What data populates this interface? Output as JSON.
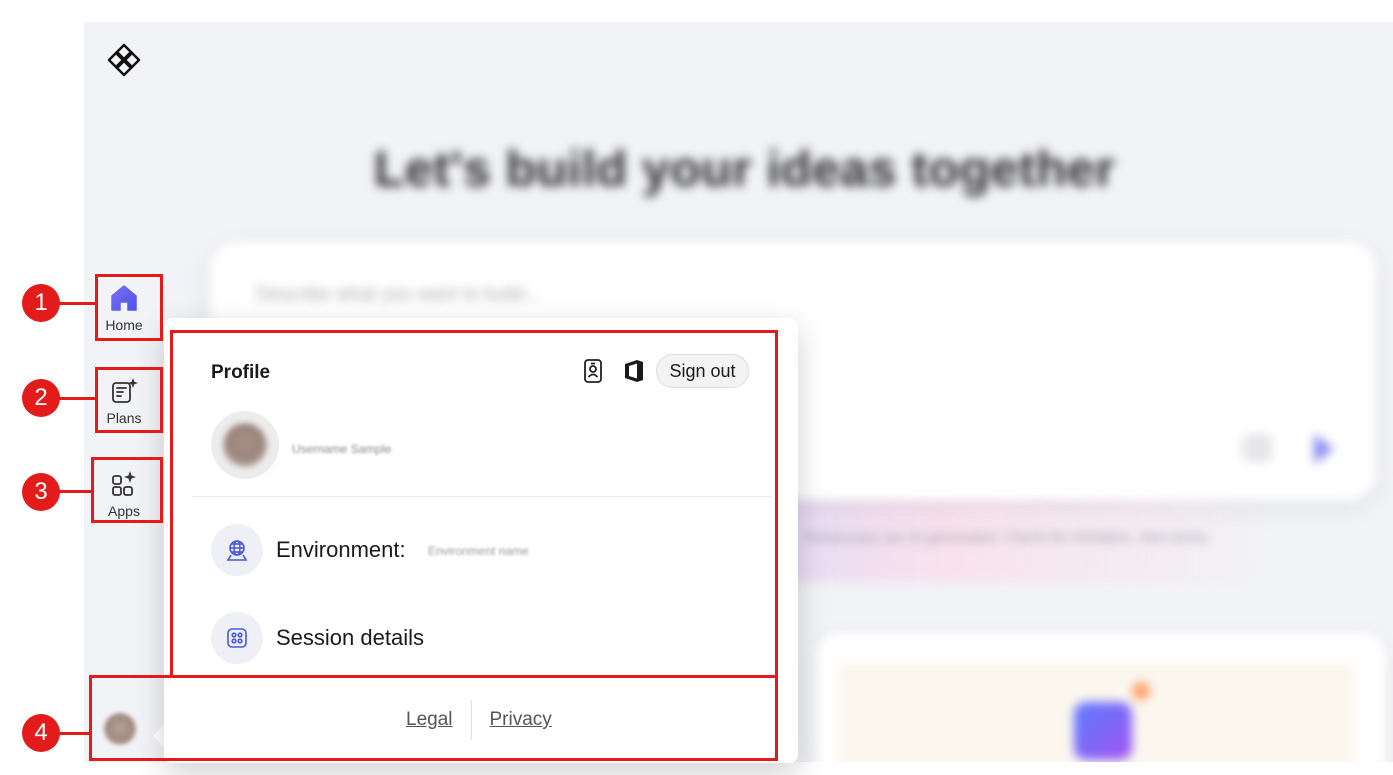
{
  "background": {
    "hero_title": "Let's build your ideas together",
    "prompt_placeholder": "Describe what you want to build...",
    "note_text": "Responses are AI-generated. Check for mistakes. See terms",
    "note_link": "See terms"
  },
  "nav": {
    "items": [
      {
        "label": "Home",
        "icon": "home-icon"
      },
      {
        "label": "Plans",
        "icon": "plans-icon"
      },
      {
        "label": "Apps",
        "icon": "apps-icon"
      }
    ]
  },
  "profile": {
    "title": "Profile",
    "sign_out": "Sign out",
    "username": "Username Sample",
    "environment_label": "Environment:",
    "environment_value": "Environment name",
    "session_details": "Session details",
    "legal": "Legal",
    "privacy": "Privacy"
  },
  "annotations": {
    "badges": [
      "1",
      "2",
      "3",
      "4"
    ]
  },
  "colors": {
    "accent": "#5b5fe6",
    "highlight": "#e41b1b",
    "app_background": "#f2f3f7"
  }
}
